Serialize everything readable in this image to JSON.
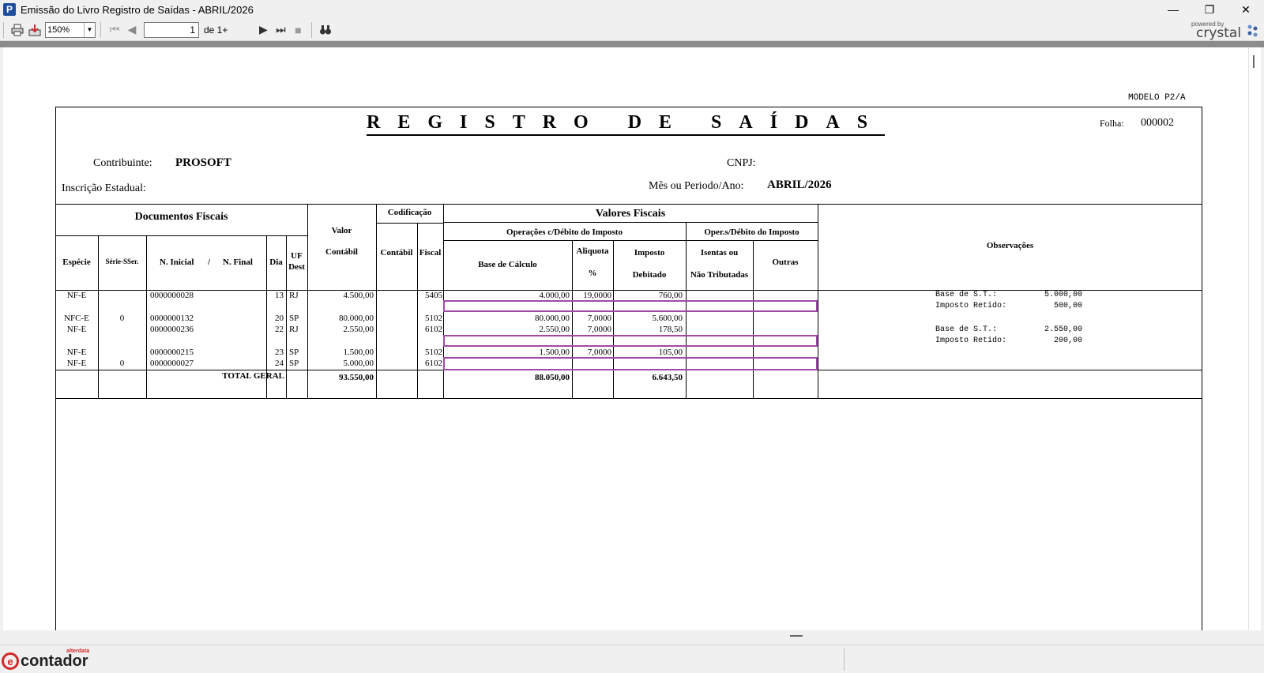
{
  "window": {
    "title": "Emissão do Livro Registro de Saídas - ABRIL/2026",
    "app_icon_letter": "P",
    "minimize": "—",
    "restore": "❐",
    "close": "✕"
  },
  "toolbar": {
    "zoom": "150%",
    "page_current": "1",
    "page_of": "de 1+",
    "powered_by": "powered by",
    "brand": "crystal"
  },
  "report": {
    "modelo": "MODELO P2/A",
    "title": "REGISTRO DE SAÍDAS",
    "folha_label": "Folha:",
    "folha_value": "000002",
    "contribuinte_label": "Contribuinte:",
    "contribuinte_value": "PROSOFT",
    "cnpj_label": "CNPJ:",
    "inscricao_label": "Inscrição Estadual:",
    "periodo_label": "Mês ou Periodo/Ano:",
    "periodo_value": "ABRIL/2026",
    "headers": {
      "documentos_fiscais": "Documentos Fiscais",
      "valor": "Valor",
      "contabil": "Contábil",
      "codificacao": "Codificação",
      "cod_contabil": "Contábil",
      "cod_fiscal": "Fiscal",
      "valores_fiscais": "Valores Fiscais",
      "operacoes_debito": "Operações c/Débito do Imposto",
      "operacoes_sem_debito": "Oper.s/Débito do Imposto",
      "observacoes": "Observações",
      "especie": "Espécie",
      "serie": "Série-SSer.",
      "n_inicial": "N. Inicial",
      "slash": "/",
      "n_final": "N. Final",
      "dia": "Dia",
      "uf": "UF",
      "dest": "Dest",
      "base_calculo": "Base de Cálculo",
      "aliquota": "Aliquota",
      "percent": "%",
      "imposto": "Imposto",
      "debitado": "Debitado",
      "isentas": "Isentas ou",
      "nao_tributadas": "Não Tributadas",
      "outras": "Outras"
    },
    "rows": [
      {
        "especie": "NF-E",
        "serie": "",
        "numero": "0000000028",
        "dia": "13",
        "uf": "RJ",
        "valor": "4.500,00",
        "fiscal": "5405",
        "base": "4.000,00",
        "aliquota": "19,0000",
        "imposto": "760,00"
      },
      {
        "especie": "NFC-E",
        "serie": "0",
        "numero": "0000000132",
        "dia": "20",
        "uf": "SP",
        "valor": "80.000,00",
        "fiscal": "5102",
        "base": "80.000,00",
        "aliquota": "7,0000",
        "imposto": "5.600,00"
      },
      {
        "especie": "NF-E",
        "serie": "",
        "numero": "0000000236",
        "dia": "22",
        "uf": "RJ",
        "valor": "2.550,00",
        "fiscal": "6102",
        "base": "2.550,00",
        "aliquota": "7,0000",
        "imposto": "178,50"
      },
      {
        "especie": "NF-E",
        "serie": "",
        "numero": "0000000215",
        "dia": "23",
        "uf": "SP",
        "valor": "1.500,00",
        "fiscal": "5102",
        "base": "1.500,00",
        "aliquota": "7,0000",
        "imposto": "105,00"
      },
      {
        "especie": "NF-E",
        "serie": "0",
        "numero": "0000000027",
        "dia": "24",
        "uf": "SP",
        "valor": "5.000,00",
        "fiscal": "6102",
        "base": "",
        "aliquota": "",
        "imposto": ""
      }
    ],
    "observacoes": [
      "Base de S.T.:          5.000,00",
      "Imposto Retido:          500,00",
      "Base de S.T.:          2.550,00",
      "Imposto Retido:          200,00"
    ],
    "total_label": "TOTAL GERAL",
    "total_valor": "93.550,00",
    "total_base": "88.050,00",
    "total_imposto": "6.643,50"
  },
  "status": {
    "brand_sup": "alterdata",
    "brand_letter": "e",
    "brand_name": "contador"
  }
}
